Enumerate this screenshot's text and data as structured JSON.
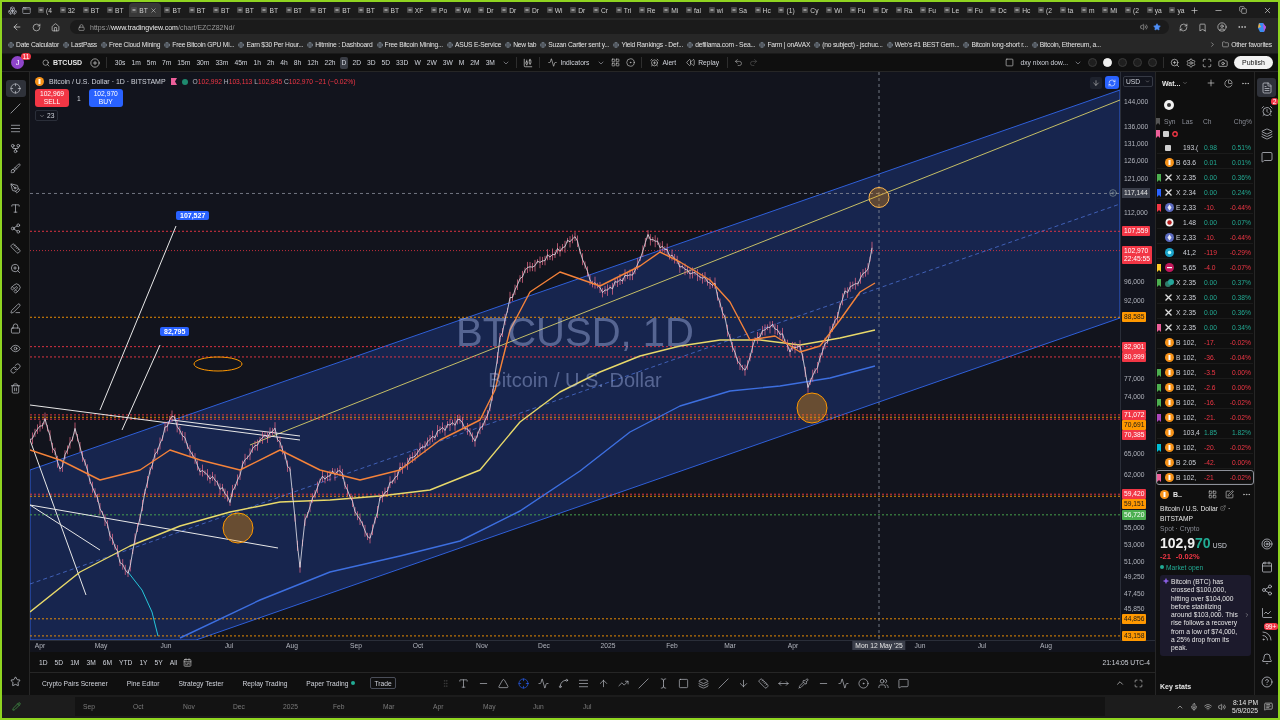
{
  "browser": {
    "tabs": [
      {
        "title": "(4",
        "selected": false
      },
      {
        "title": "32",
        "selected": false
      },
      {
        "title": "BT",
        "selected": false
      },
      {
        "title": "BT",
        "selected": false
      },
      {
        "title": "BT",
        "selected": true
      },
      {
        "title": "BT",
        "selected": false
      },
      {
        "title": "BT",
        "selected": false
      },
      {
        "title": "BT",
        "selected": false
      },
      {
        "title": "BT",
        "selected": false
      },
      {
        "title": "BT",
        "selected": false
      },
      {
        "title": "BT",
        "selected": false
      },
      {
        "title": "BT",
        "selected": false
      },
      {
        "title": "BT",
        "selected": false
      },
      {
        "title": "BT",
        "selected": false
      },
      {
        "title": "BT",
        "selected": false
      },
      {
        "title": "XF",
        "selected": false
      },
      {
        "title": "Po",
        "selected": false
      },
      {
        "title": "Wi",
        "selected": false
      },
      {
        "title": "Dr",
        "selected": false
      },
      {
        "title": "Dr",
        "selected": false
      },
      {
        "title": "Dr",
        "selected": false
      },
      {
        "title": "Wi",
        "selected": false
      },
      {
        "title": "Dr",
        "selected": false
      },
      {
        "title": "Cr",
        "selected": false
      },
      {
        "title": "Tri",
        "selected": false
      },
      {
        "title": "Re",
        "selected": false
      },
      {
        "title": "Mi",
        "selected": false
      },
      {
        "title": "fal",
        "selected": false
      },
      {
        "title": "wi",
        "selected": false
      },
      {
        "title": "Sa",
        "selected": false
      },
      {
        "title": "Hc",
        "selected": false
      },
      {
        "title": "(1)",
        "selected": false
      },
      {
        "title": "Cy",
        "selected": false
      },
      {
        "title": "Wi",
        "selected": false
      },
      {
        "title": "Fu",
        "selected": false
      },
      {
        "title": "Dr",
        "selected": false
      },
      {
        "title": "Ra",
        "selected": false
      },
      {
        "title": "Fu",
        "selected": false
      },
      {
        "title": "Le",
        "selected": false
      },
      {
        "title": "Fu",
        "selected": false
      },
      {
        "title": "Dc",
        "selected": false
      },
      {
        "title": "Hc",
        "selected": false
      },
      {
        "title": "(2",
        "selected": false
      },
      {
        "title": "ta",
        "selected": false
      },
      {
        "title": "m",
        "selected": false
      },
      {
        "title": "Mi",
        "selected": false
      },
      {
        "title": "(2",
        "selected": false
      },
      {
        "title": "ya",
        "selected": false
      },
      {
        "title": "ya",
        "selected": false
      }
    ],
    "url": {
      "scheme": "https://",
      "host": "www.tradingview.com",
      "path": "/chart/EZCZ82Nd/"
    },
    "bookmarks": [
      "Date Calculator",
      "LastPass",
      "Free Cloud Mining",
      "Free Bitcoin GPU Mi...",
      "Earn $30 Per Hour...",
      "Hitmine : Dashboard",
      "Free Bitcoin Mining...",
      "ASUS E-Service",
      "New tab",
      "Suzan Cartier sent y...",
      "Yield Rankings - Def...",
      "defillama.com - Sea...",
      "Farm | onAVAX",
      "(no subject) - jschuc...",
      "Web's #1 BEST Gem...",
      "Bitcoin long-short r...",
      "Bitcoin, Ethereum, a..."
    ],
    "other_favorites": "Other favorites"
  },
  "toolbar": {
    "avatar": "J",
    "avatar_badge": "11",
    "symbol": "BTCUSD",
    "intervals": [
      {
        "label": "30s",
        "selected": false
      },
      {
        "label": "1m",
        "selected": false
      },
      {
        "label": "5m",
        "selected": false
      },
      {
        "label": "7m",
        "selected": false
      },
      {
        "label": "15m",
        "selected": false
      },
      {
        "label": "30m",
        "selected": false
      },
      {
        "label": "33m",
        "selected": false
      },
      {
        "label": "45m",
        "selected": false
      },
      {
        "label": "1h",
        "selected": false
      },
      {
        "label": "2h",
        "selected": false
      },
      {
        "label": "4h",
        "selected": false
      },
      {
        "label": "8h",
        "selected": false
      },
      {
        "label": "12h",
        "selected": false
      },
      {
        "label": "22h",
        "selected": false
      },
      {
        "label": "D",
        "selected": true
      },
      {
        "label": "2D",
        "selected": false
      },
      {
        "label": "3D",
        "selected": false
      },
      {
        "label": "5D",
        "selected": false
      },
      {
        "label": "33D",
        "selected": false
      },
      {
        "label": "W",
        "selected": false
      },
      {
        "label": "2W",
        "selected": false
      },
      {
        "label": "3W",
        "selected": false
      },
      {
        "label": "M",
        "selected": false
      },
      {
        "label": "2M",
        "selected": false
      },
      {
        "label": "3M",
        "selected": false
      }
    ],
    "indicators": "Indicators",
    "alert": "Alert",
    "replay": "Replay",
    "layout_name": "dxy nixon dow...",
    "layout_dots": [
      {
        "selected": false
      },
      {
        "selected": true
      },
      {
        "selected": false
      },
      {
        "selected": false
      },
      {
        "selected": false
      }
    ],
    "publish": "Publish"
  },
  "drawing_tools": [
    {
      "kind": "crosshair",
      "selected": true
    },
    {
      "kind": "line",
      "selected": false
    },
    {
      "kind": "lines",
      "selected": false
    },
    {
      "kind": "fork",
      "selected": false
    },
    {
      "kind": "brush",
      "selected": false
    },
    {
      "kind": "pen",
      "selected": false
    },
    {
      "kind": "text",
      "selected": false
    },
    {
      "kind": "nodes",
      "selected": false
    },
    {
      "kind": "ruler",
      "selected": false
    },
    {
      "kind": "zoom",
      "selected": false
    },
    {
      "kind": "magnet",
      "selected": false
    },
    {
      "kind": "pencil",
      "selected": false
    },
    {
      "kind": "lock",
      "selected": false
    },
    {
      "kind": "eye",
      "selected": false
    },
    {
      "kind": "link",
      "selected": false
    },
    {
      "kind": "trash",
      "selected": false
    }
  ],
  "legend": {
    "title": "Bitcoin / U.S. Dollar · 1D · BITSTAMP",
    "ohlc": [
      {
        "label": "O",
        "value": "102,992"
      },
      {
        "label": "H",
        "value": "103,113"
      },
      {
        "label": "L",
        "value": "102,845"
      },
      {
        "label": "C",
        "value": "102,970"
      }
    ],
    "change": "−21 (−0.02%)",
    "negative": true,
    "sell": {
      "price": "102,969",
      "label": "SELL"
    },
    "spread": "1",
    "buy": {
      "price": "102,970",
      "label": "BUY"
    },
    "indicator_count": "23"
  },
  "chart": {
    "watermark_symbol": "BTCUSD, 1D",
    "watermark_name": "Bitcoin / U.S. Dollar",
    "labels": [
      "107,527",
      "82,795"
    ]
  },
  "price_axis": {
    "currency": "USD",
    "ticks": [
      "144,000",
      "136,000",
      "131,000",
      "126,000",
      "121,000",
      "112,000",
      "96,000",
      "92,000",
      "77,000",
      "74,000",
      "65,000",
      "62,000",
      "55,000",
      "53,000",
      "51,000",
      "49,250",
      "47,450",
      "45,850"
    ],
    "markers": [
      {
        "value": "107,559",
        "color": "#f23645"
      },
      {
        "value": "88,585",
        "color": "#ff9800"
      },
      {
        "value": "82,901",
        "color": "#f23645"
      },
      {
        "value": "80,999",
        "color": "#f23645"
      },
      {
        "value": "71,072",
        "color": "#f23645"
      },
      {
        "value": "70,691",
        "color": "#ff9800"
      },
      {
        "value": "70,385",
        "color": "#f23645"
      },
      {
        "value": "59,420",
        "color": "#f23645"
      },
      {
        "value": "59,151",
        "color": "#ff9800"
      },
      {
        "value": "56,720",
        "color": "#4caf50"
      },
      {
        "value": "44,856",
        "color": "#ff9800"
      },
      {
        "value": "43,158",
        "color": "#ff9800"
      }
    ],
    "crosshair": "117,144",
    "last_price": {
      "value": "102,970",
      "countdown": "22:45:55"
    }
  },
  "time_axis": {
    "ticks": [
      "Apr",
      "May",
      "Jun",
      "Jul",
      "Aug",
      "Sep",
      "Oct",
      "Nov",
      "Dec",
      "2025",
      "Feb",
      "Mar",
      "Apr",
      "Jun",
      "Jul",
      "Aug"
    ],
    "crosshair": "Mon 12 May '25",
    "clock": "21:14:05 UTC-4"
  },
  "ranges": [
    "1D",
    "5D",
    "1M",
    "3M",
    "6M",
    "YTD",
    "1Y",
    "5Y",
    "All"
  ],
  "bottom_tabs": [
    {
      "label": "Crypto Pairs Screener",
      "kind": "tab",
      "connected": false
    },
    {
      "label": "Pine Editor",
      "kind": "tab",
      "connected": false
    },
    {
      "label": "Strategy Tester",
      "kind": "tab",
      "connected": false
    },
    {
      "label": "Replay Trading",
      "kind": "tab",
      "connected": false
    },
    {
      "label": "Paper Trading",
      "kind": "tab",
      "connected": true
    },
    {
      "label": "Trade",
      "kind": "button",
      "connected": false
    }
  ],
  "drawing_toolbar": [
    {
      "kind": "text",
      "selected": false
    },
    {
      "kind": "hline",
      "selected": false
    },
    {
      "kind": "angle",
      "selected": false
    },
    {
      "kind": "crosshair",
      "selected": true
    },
    {
      "kind": "zigzag",
      "selected": false
    },
    {
      "kind": "curve",
      "selected": false
    },
    {
      "kind": "lines",
      "selected": false
    },
    {
      "kind": "arrow_up",
      "selected": false
    },
    {
      "kind": "wave",
      "selected": false
    },
    {
      "kind": "slash",
      "selected": false
    },
    {
      "kind": "cursor",
      "selected": false
    },
    {
      "kind": "square",
      "selected": false
    },
    {
      "kind": "layers",
      "selected": false
    },
    {
      "kind": "line",
      "selected": false
    },
    {
      "kind": "arrow_down",
      "selected": false
    },
    {
      "kind": "ruler",
      "selected": false
    },
    {
      "kind": "span",
      "selected": false
    },
    {
      "kind": "pipette",
      "selected": false
    },
    {
      "kind": "hline",
      "selected": false
    },
    {
      "kind": "zigzag",
      "selected": false
    },
    {
      "kind": "target",
      "selected": false
    },
    {
      "kind": "users",
      "selected": false
    },
    {
      "kind": "comment",
      "selected": false
    }
  ],
  "watchlist": {
    "title": "Wat...",
    "columns": [
      "Syn",
      "Las",
      "Ch",
      "Chg%"
    ],
    "group": {
      "color": "#ec5f9a"
    },
    "rows": [
      {
        "kind": "square",
        "last": "193.(",
        "change": "0.98",
        "change_pct": "0.51%",
        "negative": false,
        "selected": false
      },
      {
        "kind": "bitcoin",
        "symbol": "B",
        "last": "63.6",
        "change": "0.01",
        "change_pct": "0.01%",
        "negative": false,
        "selected": false
      },
      {
        "color": "#4caf50",
        "kind": "x",
        "symbol": "X",
        "last": "2.35",
        "change": "0.00",
        "change_pct": "0.36%",
        "negative": false,
        "selected": false
      },
      {
        "color": "#2962ff",
        "kind": "x",
        "symbol": "X",
        "last": "2.34",
        "change": "0.00",
        "change_pct": "0.24%",
        "negative": false,
        "selected": false
      },
      {
        "color": "#f23645",
        "kind": "ether",
        "symbol": "E",
        "last": "2,33",
        "change": "-10.",
        "change_pct": "-0.44%",
        "negative": true,
        "selected": false
      },
      {
        "kind": "ring",
        "last": "1.48",
        "change": "0.00",
        "change_pct": "0.07%",
        "negative": false,
        "selected": false
      },
      {
        "kind": "ether",
        "symbol": "E",
        "last": "2,33",
        "change": "-10.",
        "change_pct": "-0.44%",
        "negative": true,
        "selected": false
      },
      {
        "kind": "coin",
        "last": "41,2",
        "change": "-119",
        "change_pct": "-0.29%",
        "negative": true,
        "selected": false
      },
      {
        "color": "#ffca28",
        "kind": "index",
        "last": "5,65",
        "change": "-4.0",
        "change_pct": "-0.07%",
        "negative": true,
        "selected": false
      },
      {
        "color": "#4caf50",
        "kind": "pair",
        "symbol": "X",
        "last": "2.35",
        "change": "0.00",
        "change_pct": "0.37%",
        "negative": false,
        "selected": false
      },
      {
        "kind": "x",
        "symbol": "X",
        "last": "2.35",
        "change": "0.00",
        "change_pct": "0.38%",
        "negative": false,
        "selected": false
      },
      {
        "kind": "x",
        "symbol": "X",
        "last": "2.35",
        "change": "0.00",
        "change_pct": "0.36%",
        "negative": false,
        "selected": false
      },
      {
        "color": "#ec5f9a",
        "kind": "x",
        "symbol": "X",
        "last": "2.35",
        "change": "0.00",
        "change_pct": "0.34%",
        "negative": false,
        "selected": false
      },
      {
        "kind": "bitcoin",
        "symbol": "B",
        "last": "102,",
        "change": "-17.",
        "change_pct": "-0.02%",
        "negative": true,
        "selected": false
      },
      {
        "kind": "bitcoin",
        "symbol": "B",
        "last": "102,",
        "change": "-36.",
        "change_pct": "-0.04%",
        "negative": true,
        "selected": false
      },
      {
        "color": "#4caf50",
        "kind": "bitcoin",
        "symbol": "B",
        "last": "102,",
        "change": "-3.5",
        "change_pct": "0.00%",
        "negative": true,
        "selected": false
      },
      {
        "color": "#4caf50",
        "kind": "bitcoin",
        "symbol": "B",
        "last": "102,",
        "change": "-2.6",
        "change_pct": "0.00%",
        "negative": true,
        "selected": false
      },
      {
        "color": "#4caf50",
        "kind": "bitcoin",
        "symbol": "B",
        "last": "102,",
        "change": "-16.",
        "change_pct": "-0.02%",
        "negative": true,
        "selected": false
      },
      {
        "color": "#ab47bc",
        "kind": "bitcoin",
        "symbol": "B",
        "last": "102,",
        "change": "-21.",
        "change_pct": "-0.02%",
        "negative": true,
        "selected": false
      },
      {
        "kind": "bitcoin",
        "last": "103,4",
        "change": "1.85",
        "change_pct": "1.82%",
        "negative": false,
        "selected": false
      },
      {
        "color": "#00bcd4",
        "kind": "bitcoin",
        "symbol": "B",
        "last": "102,",
        "change": "-20.",
        "change_pct": "-0.02%",
        "negative": true,
        "selected": false
      },
      {
        "kind": "bitcoin",
        "symbol": "B",
        "last": "2.05",
        "change": "-42.",
        "change_pct": "0.00%",
        "negative": true,
        "selected": false
      },
      {
        "color": "#ec5f9a",
        "kind": "bitcoin",
        "symbol": "B",
        "last": "102,",
        "change": "-21",
        "change_pct": "-0.02%",
        "negative": true,
        "selected": true
      }
    ],
    "detail": {
      "symbol": "B..",
      "name": "Bitcoin / U.S. Dollar",
      "separator": "·",
      "exchange": "BITSTAMP",
      "type": "Spot · Crypto",
      "price_lead": "102,9",
      "price_tail": "70",
      "currency": "USD",
      "change": "-21",
      "change_pct": "-0.02%",
      "negative": true,
      "status": {
        "label": "Market open",
        "open": true
      },
      "news": "Bitcoin (BTC) has crossed $100,000, hitting over $104,000 before stabilizing around $103,000. This rise follows a recovery from a low of $74,000, a 25% drop from its peak.",
      "key_stats": "Key stats"
    }
  },
  "side_icons_top": [
    {
      "kind": "watchlist",
      "selected": true
    },
    {
      "kind": "alerts",
      "badge": "2",
      "selected": false
    },
    {
      "kind": "layers",
      "selected": false
    },
    {
      "kind": "chat",
      "selected": false
    }
  ],
  "side_icons_bottom": [
    {
      "kind": "target",
      "selected": false
    },
    {
      "kind": "calendar",
      "selected": false
    },
    {
      "kind": "branch",
      "selected": false
    },
    {
      "kind": "chart",
      "selected": false
    },
    {
      "kind": "signal",
      "badge": "99+",
      "selected": false
    },
    {
      "kind": "bell",
      "selected": false
    },
    {
      "kind": "help",
      "selected": false
    }
  ],
  "navigator": {
    "ticks": [
      "Sep",
      "Oct",
      "Nov",
      "Dec",
      "2025",
      "Feb",
      "Mar",
      "Apr",
      "May",
      "Jun",
      "Jul"
    ]
  },
  "taskbar": {
    "time": "8:14 PM",
    "date": "5/9/2025"
  }
}
